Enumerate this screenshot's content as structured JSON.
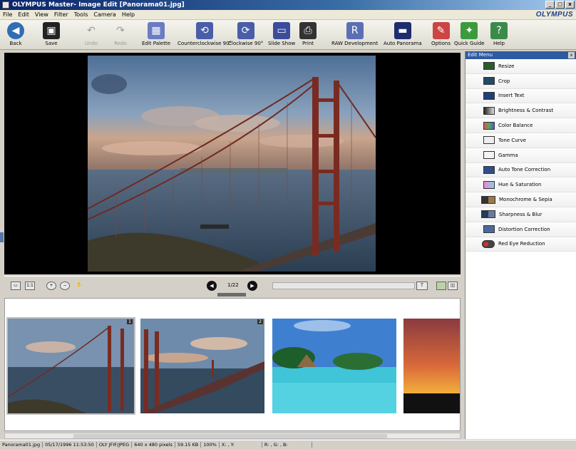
{
  "window": {
    "app_name": "OLYMPUS Master",
    "title": " - Image Edit [Panorama01.jpg]",
    "brand": "OLYMPUS"
  },
  "menu": [
    "File",
    "Edit",
    "View",
    "Filter",
    "Tools",
    "Camera",
    "Help"
  ],
  "toolbar": [
    {
      "label": "Back",
      "icon": "back-arrow-icon",
      "enabled": true
    },
    {
      "label": "Save",
      "icon": "floppy-disk-icon",
      "enabled": true
    },
    {
      "label": "Undo",
      "icon": "undo-icon",
      "enabled": false
    },
    {
      "label": "Redo",
      "icon": "redo-icon",
      "enabled": false
    },
    {
      "label": "Edit Palette",
      "icon": "palette-icon",
      "enabled": true
    },
    {
      "label": "Counterclockwise 90°",
      "icon": "rotate-ccw-icon",
      "enabled": true
    },
    {
      "label": "Clockwise 90°",
      "icon": "rotate-cw-icon",
      "enabled": true
    },
    {
      "label": "Slide Show",
      "icon": "slideshow-icon",
      "enabled": true
    },
    {
      "label": "Print",
      "icon": "printer-icon",
      "enabled": true
    },
    {
      "label": "RAW Development",
      "icon": "raw-icon",
      "enabled": true
    },
    {
      "label": "Auto Panorama",
      "icon": "panorama-icon",
      "enabled": true
    },
    {
      "label": "Options",
      "icon": "options-icon",
      "enabled": true
    },
    {
      "label": "Quick Guide",
      "icon": "guide-icon",
      "enabled": true
    },
    {
      "label": "Help",
      "icon": "help-book-icon",
      "enabled": true
    }
  ],
  "navigation": {
    "counter": "1/22"
  },
  "edit_menu": {
    "title": "Edit Menu",
    "items": [
      "Resize",
      "Crop",
      "Insert Text",
      "Brightness & Contrast",
      "Color Balance",
      "Tone Curve",
      "Gamma",
      "Auto Tone Correction",
      "Hue & Saturation",
      "Monochrome & Sepia",
      "Sharpness & Blur",
      "Distortion Correction",
      "Red Eye Reduction"
    ]
  },
  "thumbnails": [
    {
      "badge": "1",
      "selected": true
    },
    {
      "badge": "2",
      "selected": false
    },
    {
      "badge": "",
      "selected": false
    },
    {
      "badge": "",
      "selected": false
    }
  ],
  "status": {
    "filename": "Panorama01.jpg",
    "datetime": "05/17/1996 11:53:50",
    "format": "OLY JFIF/JPEG",
    "dimensions": "640 x 480 pixels",
    "size": "59.15 KB",
    "zoom": "100%",
    "coords": "X: , Y:",
    "rgb": "R: , G: , B:"
  }
}
